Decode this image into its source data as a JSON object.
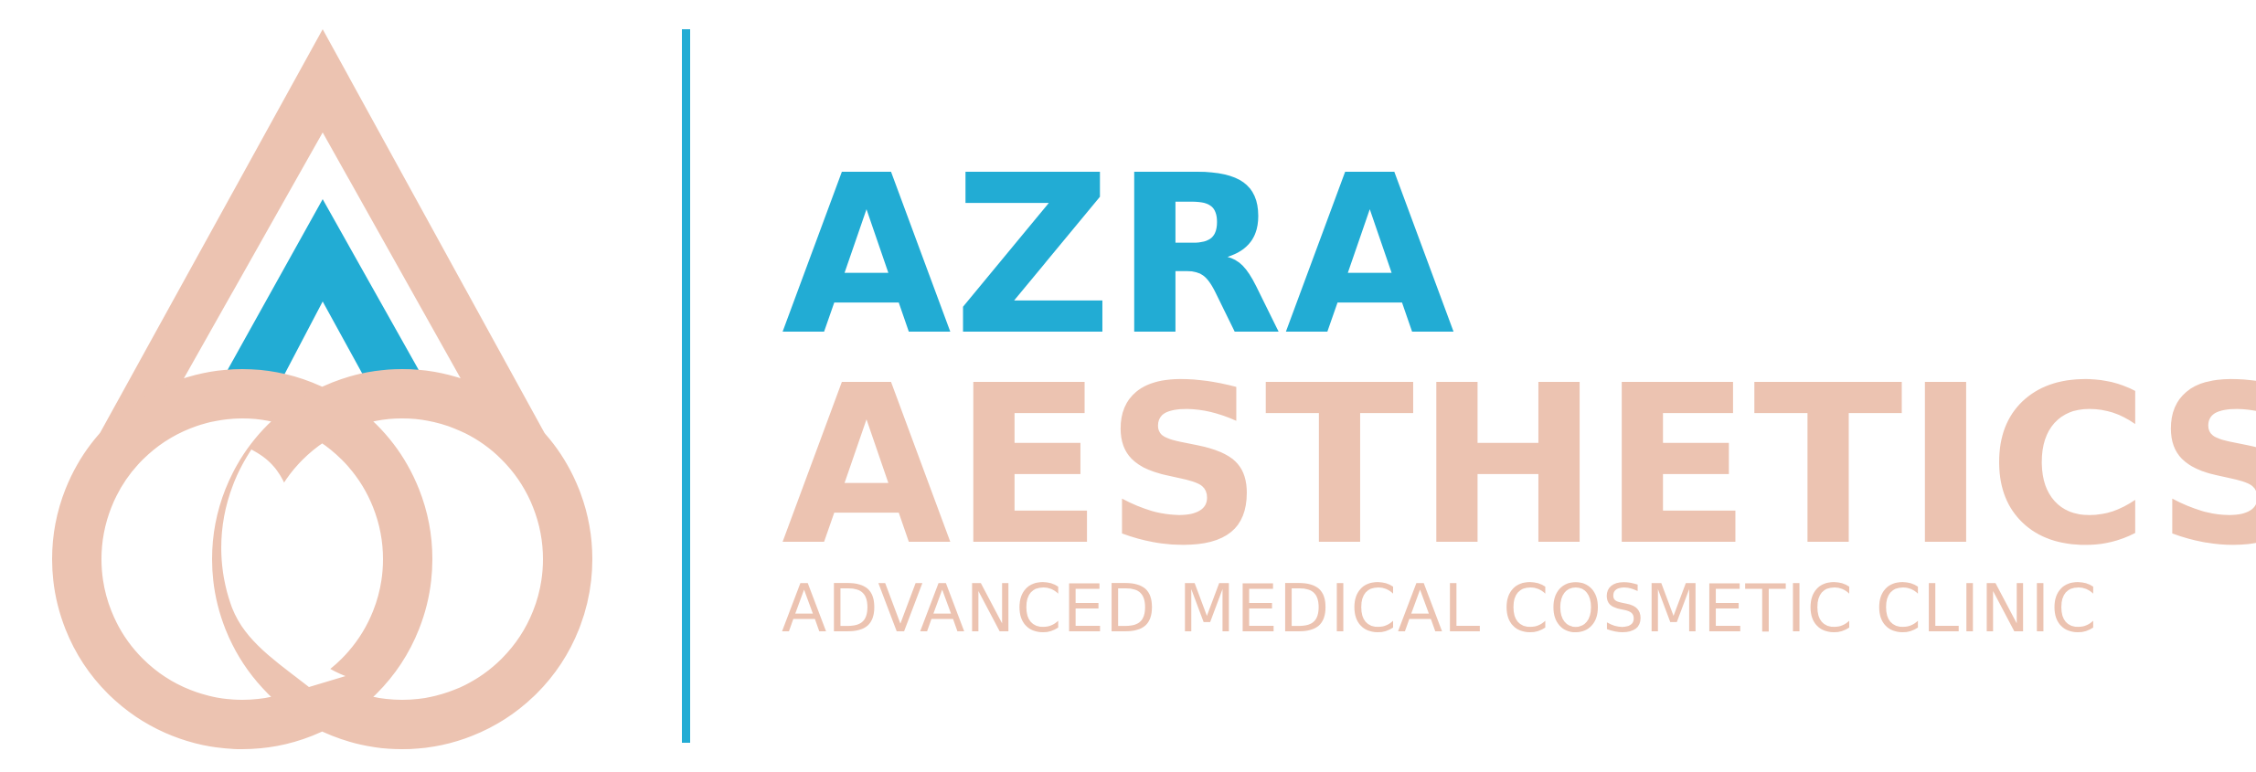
{
  "logo": {
    "icon": "drop-with-linked-rings-and-face-profile",
    "colors": {
      "teal": "#22acd4",
      "peach": "#ecc3b1"
    }
  },
  "brand": {
    "name_line_1": "AZRA",
    "name_line_2": "AESTHETICS",
    "tagline": "ADVANCED MEDICAL COSMETIC CLINIC"
  }
}
